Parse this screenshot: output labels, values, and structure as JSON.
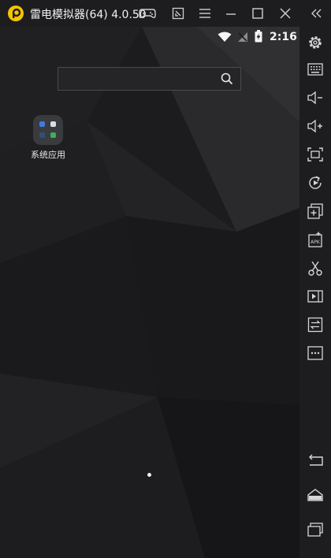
{
  "window": {
    "title": "雷电模拟器(64) 4.0.50",
    "brand_color": "#f5c400"
  },
  "statusbar": {
    "time": "2:16"
  },
  "home": {
    "search_placeholder": "",
    "folder_label": "系统应用"
  },
  "sidebar": {
    "items": [
      "settings-icon",
      "keyboard-icon",
      "volume-down-icon",
      "volume-up-icon",
      "fullscreen-icon",
      "rotate-icon",
      "add-app-icon",
      "apk-install-icon",
      "screenshot-icon",
      "record-icon",
      "sync-icon",
      "more-icon",
      "back-icon",
      "home-icon",
      "recents-icon"
    ]
  }
}
